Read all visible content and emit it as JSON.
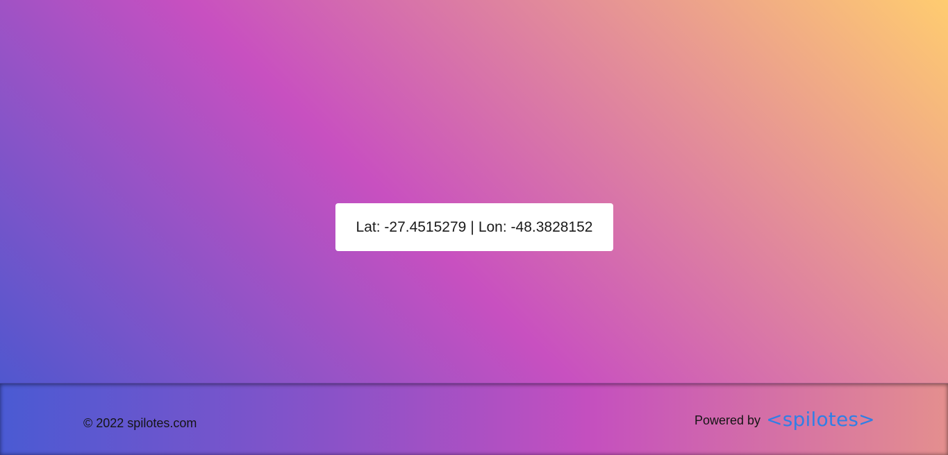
{
  "location": {
    "lat_label": "Lat:",
    "lat_value": "-27.4515279",
    "separator": "|",
    "lon_label": "Lon:",
    "lon_value": "-48.3828152"
  },
  "footer": {
    "copyright": "© 2022 spilotes.com",
    "powered_by": "Powered by",
    "brand": "<spilotes>"
  },
  "colors": {
    "gradient_start": "#4158d0",
    "gradient_mid": "#c850c0",
    "gradient_end": "#ffcc70",
    "brand": "#2f7fe6",
    "card_background": "#ffffff"
  }
}
